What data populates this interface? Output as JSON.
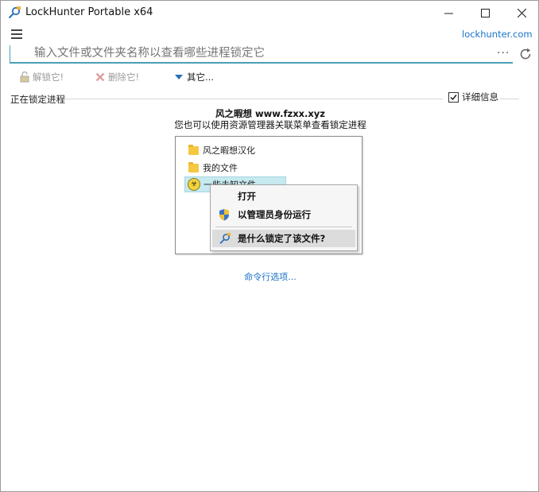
{
  "window": {
    "title": "LockHunter Portable x64",
    "controls": [
      "minimize",
      "maximize",
      "close"
    ]
  },
  "header": {
    "menu_icon": "hamburger-icon",
    "site_link": "lockhunter.com"
  },
  "search": {
    "placeholder": "输入文件或文件夹名称以查看哪些进程锁定它",
    "more_label": "···",
    "refresh_icon": "refresh-icon"
  },
  "toolbar": {
    "unlock_label": "解锁它!",
    "delete_label": "删除它!",
    "other_label": "其它..."
  },
  "process_section": {
    "label": "正在锁定进程",
    "details_label": "详细信息",
    "details_checked": true
  },
  "promo": {
    "title": "风之暇想 www.fzxx.xyz",
    "subtitle": "您也可以使用资源管理器关联菜单查看锁定进程"
  },
  "demo": {
    "files": [
      "风之暇想汉化",
      "我的文件"
    ],
    "hazard_file": "一些未知文件...",
    "context_menu": {
      "open": "打开",
      "run_as_admin": "以管理员身份运行",
      "what_locks": "是什么锁定了该文件?"
    }
  },
  "footer_link": "命令行选项...",
  "colors": {
    "accent": "#4ba0b6",
    "link": "#1a73c9",
    "selection": "#c7e9f0"
  }
}
